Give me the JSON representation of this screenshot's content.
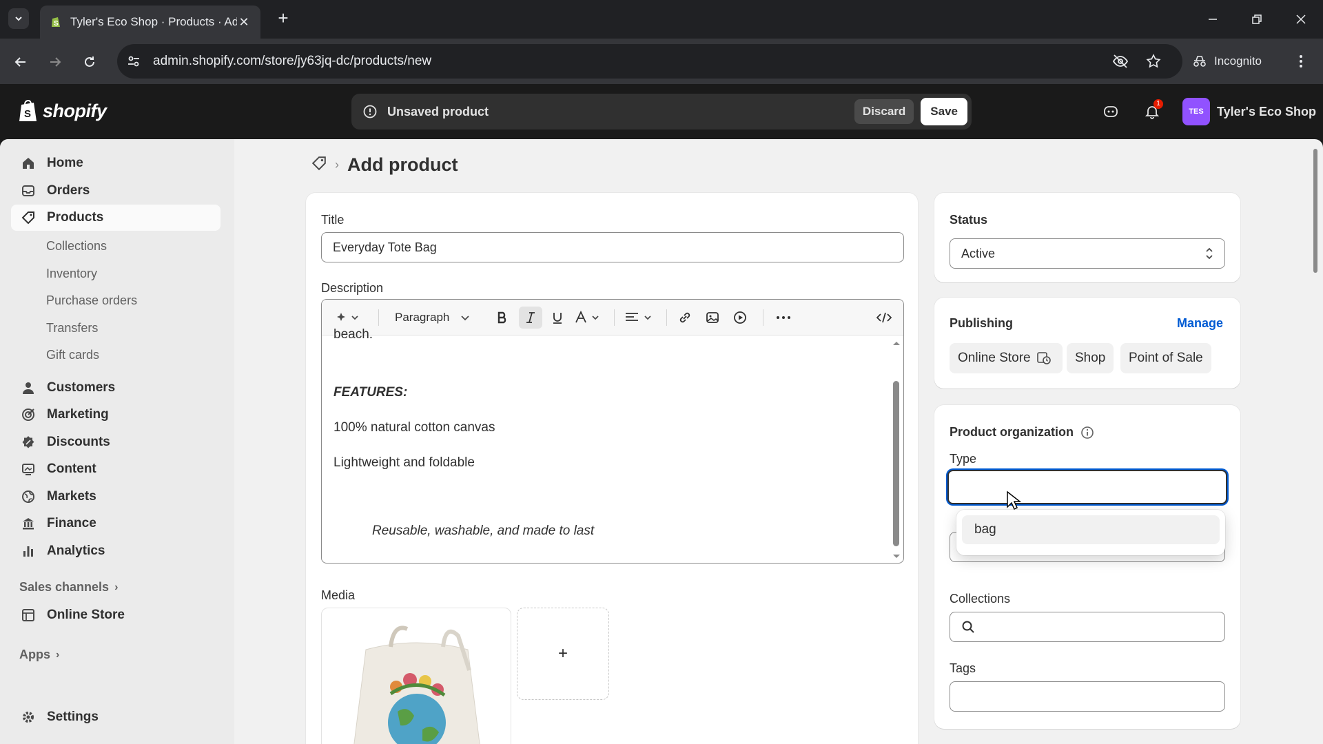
{
  "browser": {
    "tab_title": "Tyler's Eco Shop · Products · Ad",
    "url": "admin.shopify.com/store/jy63jq-dc/products/new",
    "incognito_label": "Incognito"
  },
  "topbar": {
    "logo_text": "shopify",
    "unsaved_text": "Unsaved product",
    "discard_label": "Discard",
    "save_label": "Save",
    "notification_count": "1",
    "store_initials": "TES",
    "store_name": "Tyler's Eco Shop"
  },
  "sidebar": {
    "items": [
      {
        "label": "Home",
        "icon": "home-icon"
      },
      {
        "label": "Orders",
        "icon": "orders-icon"
      },
      {
        "label": "Products",
        "icon": "tag-icon"
      },
      {
        "label": "Customers",
        "icon": "person-icon"
      },
      {
        "label": "Marketing",
        "icon": "target-icon"
      },
      {
        "label": "Discounts",
        "icon": "discount-icon"
      },
      {
        "label": "Content",
        "icon": "content-icon"
      },
      {
        "label": "Markets",
        "icon": "globe-icon"
      },
      {
        "label": "Finance",
        "icon": "bank-icon"
      },
      {
        "label": "Analytics",
        "icon": "chart-icon"
      }
    ],
    "product_subitems": [
      "Collections",
      "Inventory",
      "Purchase orders",
      "Transfers",
      "Gift cards"
    ],
    "sales_channels_label": "Sales channels",
    "online_store_label": "Online Store",
    "apps_label": "Apps",
    "settings_label": "Settings"
  },
  "main": {
    "page_title": "Add product",
    "title_label": "Title",
    "title_value": "Everyday Tote Bag",
    "description_label": "Description",
    "toolbar": {
      "paragraph_label": "Paragraph"
    },
    "description_lines": {
      "cut_off": "beach.",
      "features_heading": "FEATURES:",
      "feature_1": "100% natural cotton canvas",
      "feature_2": "Lightweight and foldable",
      "tagline": "Reusable, washable, and made to last"
    },
    "media_label": "Media",
    "add_media_symbol": "+"
  },
  "side": {
    "status_label": "Status",
    "status_value": "Active",
    "publishing_label": "Publishing",
    "manage_label": "Manage",
    "channels": [
      "Online Store",
      "Shop",
      "Point of Sale"
    ],
    "organization_label": "Product organization",
    "type_label": "Type",
    "type_value": "",
    "type_suggestion": "bag",
    "collections_label": "Collections",
    "tags_label": "Tags"
  },
  "colors": {
    "shopify_green": "#95bf47",
    "store_avatar": "#9152ff",
    "focus_ring": "#005bd3",
    "manage_link": "#005bd3"
  }
}
